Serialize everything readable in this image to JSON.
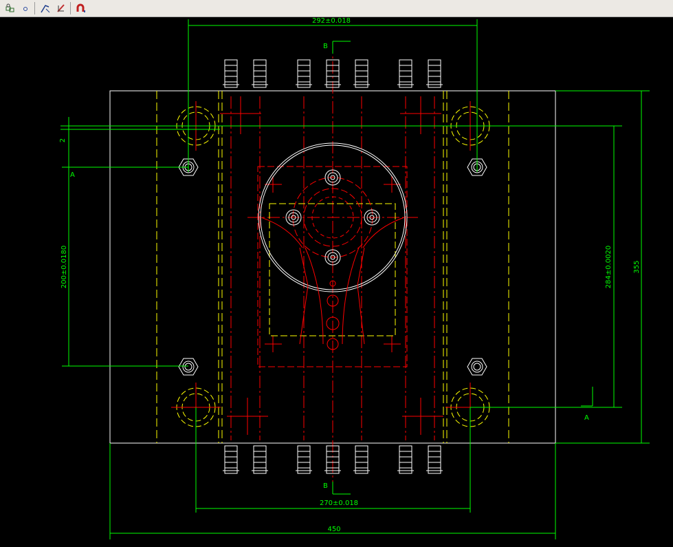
{
  "toolbar": {
    "buttons": [
      {
        "name": "layers-icon",
        "label": ""
      },
      {
        "name": "circle-icon",
        "label": ""
      },
      {
        "name": "draw-icon",
        "label": ""
      },
      {
        "name": "magnet-edit-icon",
        "label": ""
      },
      {
        "name": "magnet-icon",
        "label": ""
      }
    ]
  },
  "dimensions": {
    "top_width": "292±0.018",
    "bottom_inner_width": "270±0.018",
    "overall_width": "450",
    "left_pitch": "200±0.0180",
    "right_pitch": "284±0.0020",
    "overall_height": "355",
    "small_gap": "2"
  },
  "section_labels": {
    "b_top": "B",
    "b_bottom": "B",
    "a_left": "A",
    "a_right": "A"
  },
  "colors": {
    "outline": "#ffffff",
    "dimension": "#00ff00",
    "centerline": "#ff0000",
    "hidden": "#ffff00"
  }
}
